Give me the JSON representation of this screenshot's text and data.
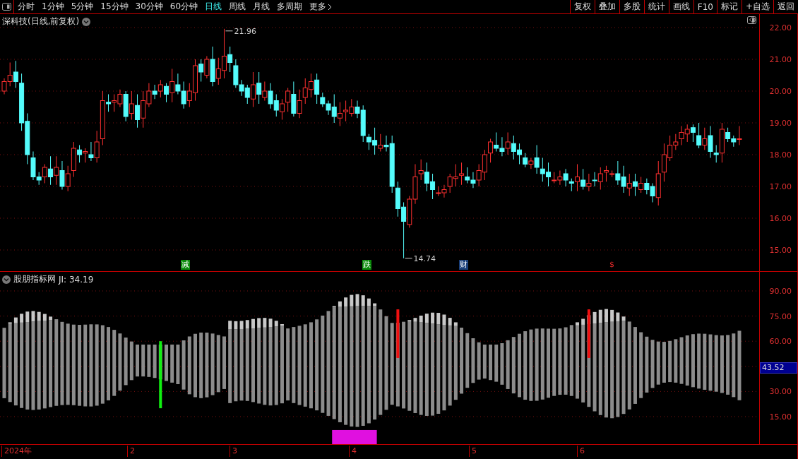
{
  "toolbar": {
    "periods": [
      {
        "label": "分时",
        "selected": false
      },
      {
        "label": "1分钟",
        "selected": false
      },
      {
        "label": "5分钟",
        "selected": false
      },
      {
        "label": "15分钟",
        "selected": false
      },
      {
        "label": "30分钟",
        "selected": false
      },
      {
        "label": "60分钟",
        "selected": false
      },
      {
        "label": "日线",
        "selected": true
      },
      {
        "label": "周线",
        "selected": false
      },
      {
        "label": "月线",
        "selected": false
      },
      {
        "label": "多周期",
        "selected": false
      },
      {
        "label": "更多",
        "selected": false
      }
    ],
    "actions": [
      "复权",
      "叠加",
      "多股",
      "统计",
      "画线",
      "F10",
      "标记",
      "+自选",
      "返回"
    ]
  },
  "price_chart": {
    "title": "深科技(日线,前复权)",
    "high_label": "21.96",
    "low_label": "14.74",
    "yticks": [
      "22.00",
      "21.00",
      "20.00",
      "19.00",
      "18.00",
      "17.00",
      "16.00",
      "15.00"
    ],
    "event_marks": [
      {
        "label": "减",
        "kind": "badge",
        "color": "#0a8a0a"
      },
      {
        "label": "跌",
        "kind": "badge",
        "color": "#0a8a0a"
      },
      {
        "label": "财",
        "kind": "badge",
        "color": "#1a3f7a"
      },
      {
        "label": "$",
        "kind": "symbol",
        "color": "#e02828"
      }
    ]
  },
  "indicator": {
    "title": "股朋指标网",
    "reading": "JI: 34.19",
    "yticks": [
      "90.00",
      "75.00",
      "60.00",
      "30.00",
      "15.00"
    ],
    "cursor_value": "43.52"
  },
  "date_axis": {
    "labels": [
      "2024年",
      "2",
      "3",
      "4",
      "5",
      "6"
    ]
  }
}
